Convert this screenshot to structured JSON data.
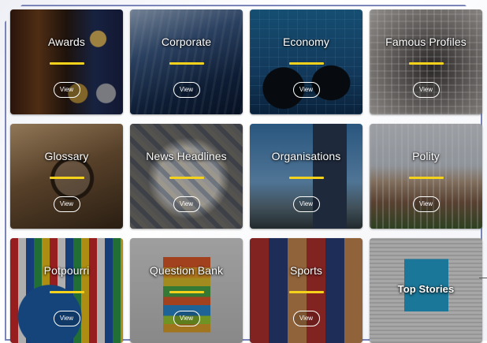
{
  "tiles": [
    {
      "id": "awards",
      "label": "Awards",
      "view": "View"
    },
    {
      "id": "corporate",
      "label": "Corporate",
      "view": "View"
    },
    {
      "id": "economy",
      "label": "Economy",
      "view": "View"
    },
    {
      "id": "famous",
      "label": "Famous Profiles",
      "view": "View"
    },
    {
      "id": "glossary",
      "label": "Glossary",
      "view": "View"
    },
    {
      "id": "news",
      "label": "News Headlines",
      "view": "View"
    },
    {
      "id": "orgs",
      "label": "Organisations",
      "view": "View"
    },
    {
      "id": "polity",
      "label": "Polity",
      "view": "View"
    },
    {
      "id": "potpourri",
      "label": "Potpourri",
      "view": "View"
    },
    {
      "id": "qbank",
      "label": "Question Bank",
      "view": "View"
    },
    {
      "id": "sports",
      "label": "Sports",
      "view": "View"
    },
    {
      "id": "topstories",
      "label": "Top Stories"
    }
  ],
  "accent_color": "#f4d21c",
  "frame_color": "#7b84b8"
}
